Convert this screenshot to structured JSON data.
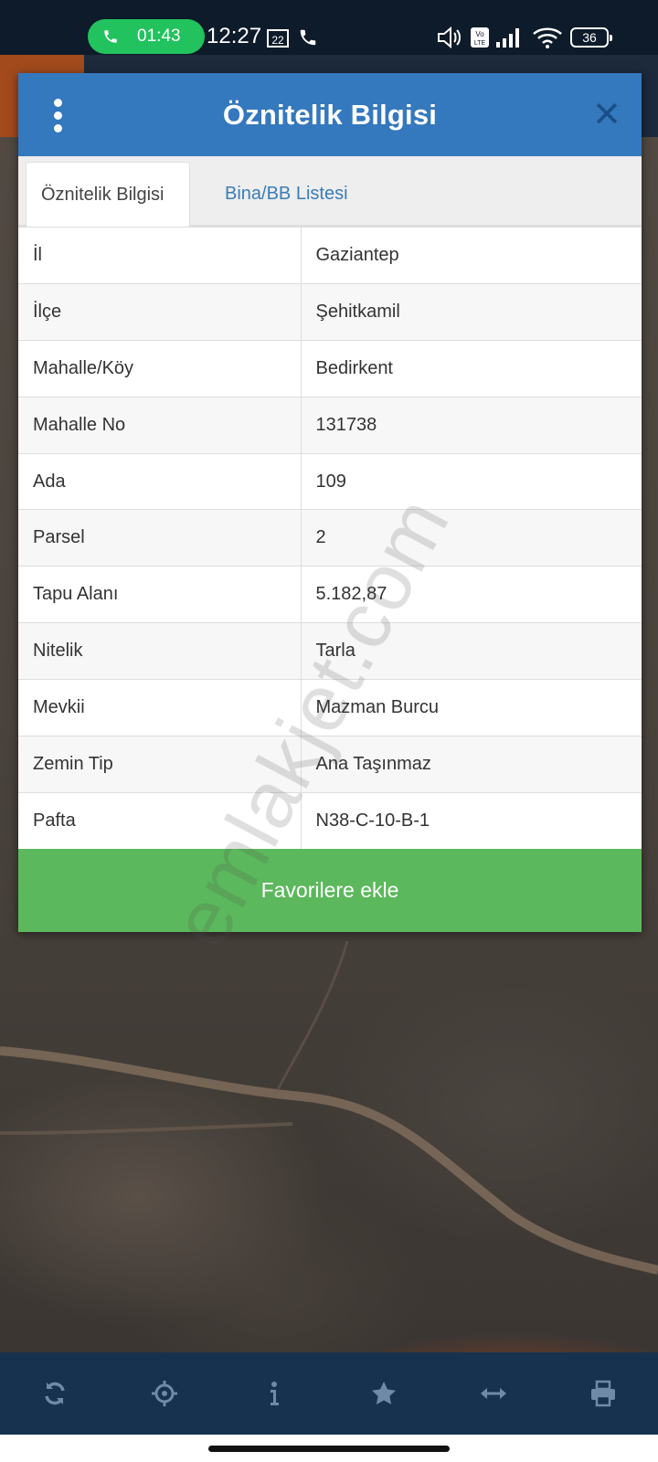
{
  "status_bar": {
    "call_timer": "01:43",
    "clock": "12:27",
    "battery": "36"
  },
  "dialog": {
    "title": "Öznitelik Bilgisi",
    "tabs": [
      {
        "label": "Öznitelik Bilgisi",
        "active": true
      },
      {
        "label": "Bina/BB Listesi",
        "active": false
      }
    ],
    "rows": [
      {
        "key": "İl",
        "value": "Gaziantep"
      },
      {
        "key": "İlçe",
        "value": "Şehitkamil"
      },
      {
        "key": "Mahalle/Köy",
        "value": "Bedirkent"
      },
      {
        "key": "Mahalle No",
        "value": "131738"
      },
      {
        "key": "Ada",
        "value": "109"
      },
      {
        "key": "Parsel",
        "value": "2"
      },
      {
        "key": "Tapu Alanı",
        "value": "5.182,87"
      },
      {
        "key": "Nitelik",
        "value": "Tarla"
      },
      {
        "key": "Mevkii",
        "value": "Mazman Burcu"
      },
      {
        "key": "Zemin Tip",
        "value": "Ana Taşınmaz"
      },
      {
        "key": "Pafta",
        "value": "N38-C-10-B-1"
      }
    ],
    "favorite_button": "Favorilere ekle"
  },
  "watermark": "emlakjet.com",
  "toolbar": {
    "items": [
      "refresh-icon",
      "locate-icon",
      "info-icon",
      "star-icon",
      "measure-icon",
      "print-icon"
    ]
  },
  "colors": {
    "header_blue": "#3478bd",
    "toolbar_navy": "#16324f",
    "favorite_green": "#5cb85c",
    "call_green": "#22c35e",
    "tab_link_blue": "#3a7cb8"
  }
}
